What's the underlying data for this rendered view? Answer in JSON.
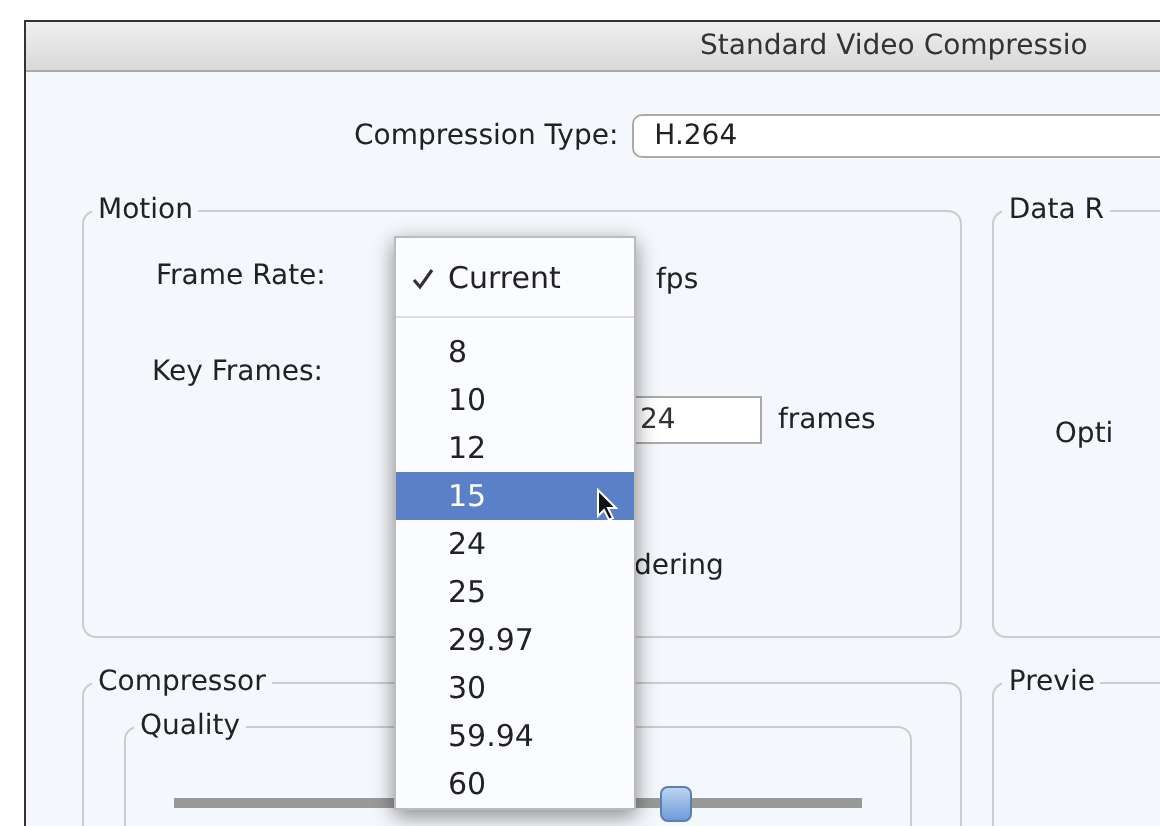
{
  "window": {
    "title": "Standard Video Compressio"
  },
  "compression_type": {
    "label": "Compression Type:",
    "value": "H.264"
  },
  "motion": {
    "title": "Motion",
    "frame_rate": {
      "label": "Frame Rate:",
      "unit": "fps"
    },
    "key_frames": {
      "label": "Key Frames:",
      "value": "24",
      "unit": "frames"
    },
    "reordering_fragment": "dering"
  },
  "data_rate": {
    "title": "Data R",
    "option_fragment": "Opti"
  },
  "compressor": {
    "title": "Compressor",
    "quality": {
      "title": "Quality",
      "level": 0.73
    }
  },
  "preview": {
    "title": "Previe"
  },
  "frame_rate_menu": {
    "items": [
      {
        "kind": "item",
        "label": "Current",
        "checked": true,
        "selected": false
      },
      {
        "kind": "separator"
      },
      {
        "kind": "item",
        "label": "8",
        "checked": false,
        "selected": false
      },
      {
        "kind": "item",
        "label": "10",
        "checked": false,
        "selected": false
      },
      {
        "kind": "item",
        "label": "12",
        "checked": false,
        "selected": false
      },
      {
        "kind": "item",
        "label": "15",
        "checked": false,
        "selected": true
      },
      {
        "kind": "item",
        "label": "24",
        "checked": false,
        "selected": false
      },
      {
        "kind": "item",
        "label": "25",
        "checked": false,
        "selected": false
      },
      {
        "kind": "item",
        "label": "29.97",
        "checked": false,
        "selected": false
      },
      {
        "kind": "item",
        "label": "30",
        "checked": false,
        "selected": false
      },
      {
        "kind": "item",
        "label": "59.94",
        "checked": false,
        "selected": false
      },
      {
        "kind": "item",
        "label": "60",
        "checked": false,
        "selected": false
      }
    ]
  }
}
